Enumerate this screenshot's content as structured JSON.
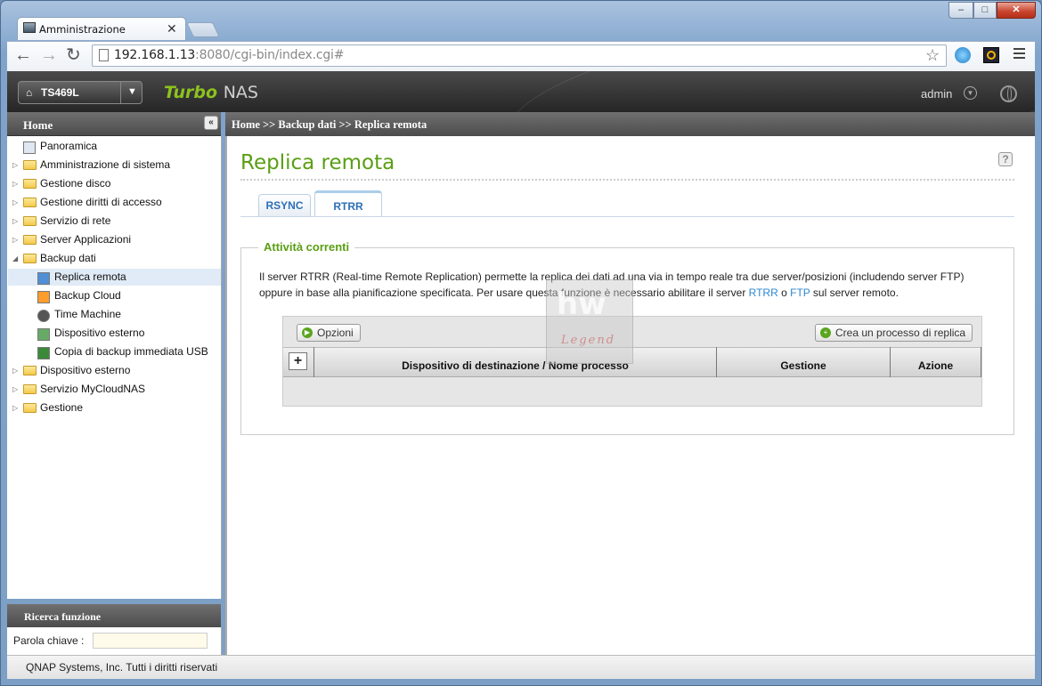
{
  "browser": {
    "tab_title": "Amministrazione",
    "url_host": "192.168.1.13",
    "url_rest": ":8080/cgi-bin/index.cgi#"
  },
  "header": {
    "device_name": "TS469L",
    "brand_turbo": "Turbo",
    "brand_nas": "NAS",
    "user": "admin"
  },
  "sidebar": {
    "title": "Home",
    "items": [
      {
        "label": "Panoramica",
        "icon": "overview-icon",
        "level": 0,
        "expanded": false
      },
      {
        "label": "Amministrazione di sistema",
        "icon": "folder-icon",
        "level": 0
      },
      {
        "label": "Gestione disco",
        "icon": "folder-icon",
        "level": 0
      },
      {
        "label": "Gestione diritti di accesso",
        "icon": "folder-icon",
        "level": 0
      },
      {
        "label": "Servizio di rete",
        "icon": "folder-icon",
        "level": 0
      },
      {
        "label": "Server Applicazioni",
        "icon": "folder-icon",
        "level": 0
      },
      {
        "label": "Backup dati",
        "icon": "folder-open-icon",
        "level": 0,
        "expanded": true
      },
      {
        "label": "Replica remota",
        "icon": "replication-icon",
        "level": 1,
        "selected": true
      },
      {
        "label": "Backup Cloud",
        "icon": "cloud-icon",
        "level": 1
      },
      {
        "label": "Time Machine",
        "icon": "apple-icon",
        "level": 1
      },
      {
        "label": "Dispositivo esterno",
        "icon": "usb-icon",
        "level": 1
      },
      {
        "label": "Copia di backup immediata USB",
        "icon": "usb-copy-icon",
        "level": 1
      },
      {
        "label": "Dispositivo esterno",
        "icon": "folder-icon",
        "level": 0
      },
      {
        "label": "Servizio MyCloudNAS",
        "icon": "folder-icon",
        "level": 0
      },
      {
        "label": "Gestione",
        "icon": "folder-icon",
        "level": 0
      }
    ],
    "search_title": "Ricerca funzione",
    "search_label": "Parola chiave :",
    "search_value": ""
  },
  "main": {
    "breadcrumb": "Home >> Backup dati >> Replica remota",
    "title": "Replica remota",
    "tabs": [
      {
        "label": "RSYNC"
      },
      {
        "label": "RTRR",
        "active": true
      }
    ],
    "section_title": "Attività correnti",
    "desc_1": "Il server RTRR (Real-time Remote Replication) permette la replica dei dati ad una via in tempo reale tra due server/posizioni (includendo server FTP)",
    "desc_2a": "oppure in base alla pianificazione specificata. Per usare questa funzione è necessario abilitare il server ",
    "desc_link1": "RTRR",
    "desc_2b": " o ",
    "desc_link2": "FTP",
    "desc_2c": " sul server remoto.",
    "options_button": "Opzioni",
    "create_button": "Crea un processo di replica",
    "columns": [
      "Dispositivo di destinazione / Nome processo",
      "Gestione",
      "Azione"
    ],
    "rows": [],
    "watermark": "Legend"
  },
  "footer": "QNAP Systems, Inc. Tutti i diritti riservati"
}
